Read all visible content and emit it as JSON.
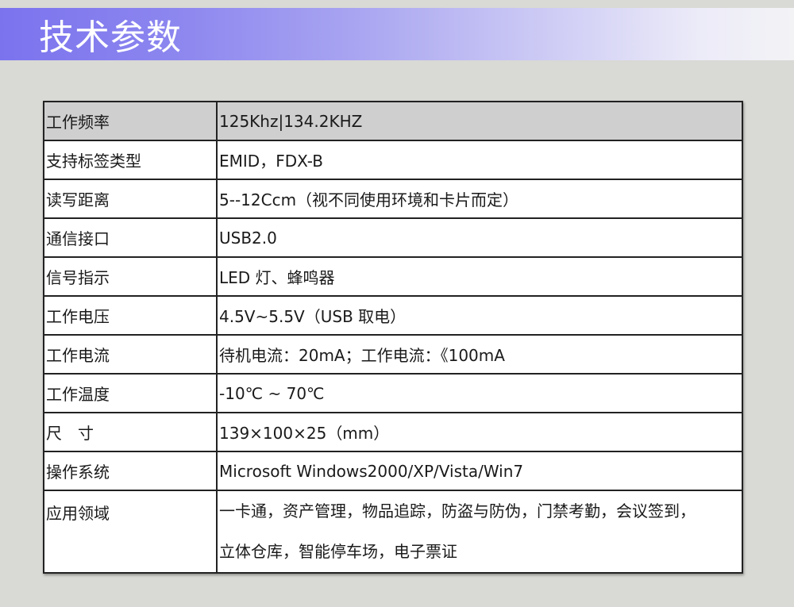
{
  "header": {
    "title": "技术参数",
    "gradient_start": "#7b73ee",
    "gradient_end": "#f3f3f6"
  },
  "table": {
    "rows": [
      {
        "label": "工作频率",
        "value": "125Khz|134.2KHZ"
      },
      {
        "label": "支持标签类型",
        "value": "EMID，FDX-B"
      },
      {
        "label": "读写距离",
        "value": "5--12Ccm（视不同使用环境和卡片而定）"
      },
      {
        "label": "通信接口",
        "value": "USB2.0"
      },
      {
        "label": "信号指示",
        "value": "LED 灯、蜂鸣器"
      },
      {
        "label": "工作电压",
        "value": "4.5V~5.5V（USB 取电）"
      },
      {
        "label": "工作电流",
        "value": "待机电流：20mA；工作电流：《100mA"
      },
      {
        "label": "工作温度",
        "value": "-10℃ ~ 70℃"
      },
      {
        "label": "尺　寸",
        "value": "139×100×25（mm）"
      },
      {
        "label": "操作系统",
        "value": "Microsoft Windows2000/XP/Vista/Win7"
      },
      {
        "label": "应用领域",
        "value_lines": [
          "一卡通，资产管理，物品追踪，防盗与防伪，门禁考勤，会议签到，",
          "立体仓库，智能停车场，电子票证"
        ]
      }
    ]
  }
}
